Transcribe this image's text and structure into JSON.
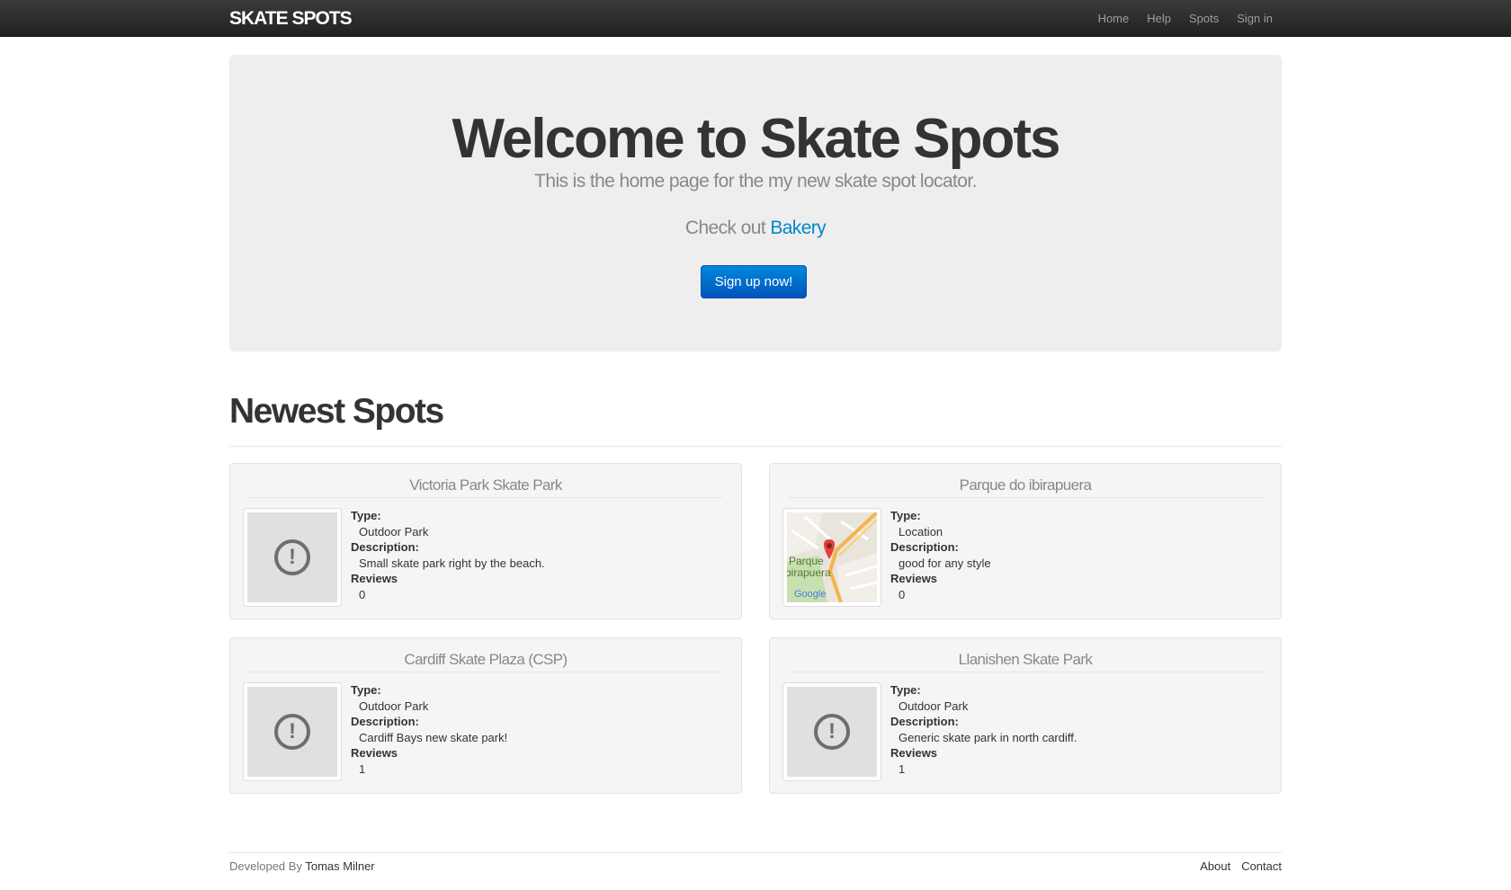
{
  "navbar": {
    "brand": "SKATE SPOTS",
    "links": [
      "Home",
      "Help",
      "Spots",
      "Sign in"
    ]
  },
  "hero": {
    "title": "Welcome to Skate Spots",
    "subtitle": "This is the home page for the my new skate spot locator.",
    "check_prefix": "Check out",
    "check_link": "Bakery",
    "signup_label": "Sign up now!"
  },
  "newest": {
    "title": "Newest Spots",
    "labels": {
      "type": "Type:",
      "description": "Description:",
      "reviews": "Reviews"
    },
    "spots": [
      {
        "name": "Victoria Park Skate Park",
        "type": "Outdoor Park",
        "description": "Small skate park right by the beach.",
        "reviews": "0",
        "image": "placeholder-icon"
      },
      {
        "name": "Parque do ibirapuera",
        "type": "Location",
        "description": "good for any style",
        "reviews": "0",
        "image": "map-thumbnail",
        "map_label_1": "Parque",
        "map_label_2": "birapuera",
        "map_logo": "Google"
      },
      {
        "name": "Cardiff Skate Plaza (CSP)",
        "type": "Outdoor Park",
        "description": "Cardiff Bays new skate park!",
        "reviews": "1",
        "image": "placeholder-icon"
      },
      {
        "name": "Llanishen Skate Park",
        "type": "Outdoor Park",
        "description": "Generic skate park in north cardiff.",
        "reviews": "1",
        "image": "placeholder-icon"
      }
    ]
  },
  "footer": {
    "developed_by": "Developed By",
    "author": "Tomas Milner",
    "links": [
      "About",
      "Contact"
    ]
  },
  "colors": {
    "navbar": "#222222",
    "brand_text": "#ffffff",
    "link": "#0088cc",
    "button": "#0070cc",
    "hero_bg": "#eeeeee",
    "card_bg": "#f5f5f5"
  }
}
